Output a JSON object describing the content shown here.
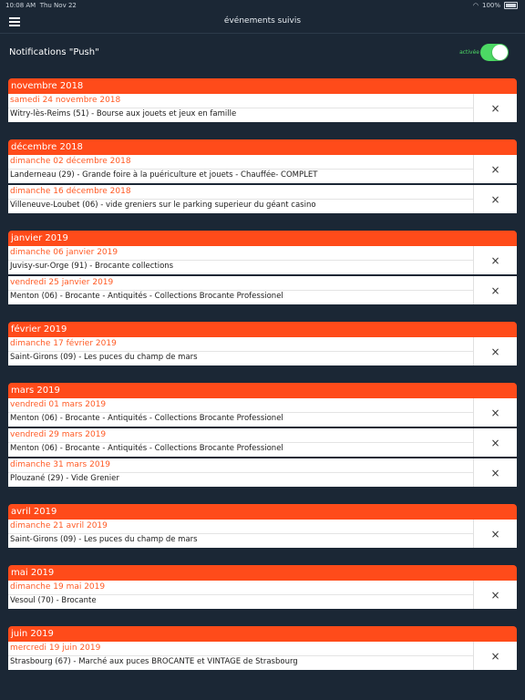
{
  "status": {
    "time": "10:08 AM",
    "date": "Thu Nov 22",
    "battery": "100%"
  },
  "nav": {
    "title": "événements suivis"
  },
  "push": {
    "label": "Notifications \"Push\"",
    "state_label": "activée",
    "enabled": true
  },
  "months": [
    {
      "label": "novembre 2018",
      "events": [
        {
          "date": "samedi 24 novembre 2018",
          "title": "Witry-lès-Reims (51) - Bourse aux jouets et jeux en famille"
        }
      ]
    },
    {
      "label": "décembre 2018",
      "events": [
        {
          "date": "dimanche 02 décembre 2018",
          "title": "Landerneau (29) - Grande foire à la puériculture et jouets - Chauffée- COMPLET"
        },
        {
          "date": "dimanche 16 décembre 2018",
          "title": "Villeneuve-Loubet (06) - vide greniers sur le parking superieur du géant casino"
        }
      ]
    },
    {
      "label": "janvier 2019",
      "events": [
        {
          "date": "dimanche 06 janvier 2019",
          "title": "Juvisy-sur-Orge (91) - Brocante collections"
        },
        {
          "date": "vendredi 25 janvier 2019",
          "title": "Menton (06) - Brocante - Antiquités - Collections Brocante Professionel"
        }
      ]
    },
    {
      "label": "février 2019",
      "events": [
        {
          "date": "dimanche 17 février 2019",
          "title": "Saint-Girons (09) - Les puces du champ de mars"
        }
      ]
    },
    {
      "label": "mars 2019",
      "events": [
        {
          "date": "vendredi 01 mars 2019",
          "title": "Menton (06) - Brocante - Antiquités - Collections Brocante Professionel"
        },
        {
          "date": "vendredi 29 mars 2019",
          "title": "Menton (06) - Brocante - Antiquités - Collections Brocante Professionel"
        },
        {
          "date": "dimanche 31 mars 2019",
          "title": "Plouzané (29) - Vide Grenier"
        }
      ]
    },
    {
      "label": "avril 2019",
      "events": [
        {
          "date": "dimanche 21 avril 2019",
          "title": "Saint-Girons (09) - Les puces du champ de mars"
        }
      ]
    },
    {
      "label": "mai 2019",
      "events": [
        {
          "date": "dimanche 19 mai 2019",
          "title": "Vesoul (70) - Brocante"
        }
      ]
    },
    {
      "label": "juin 2019",
      "events": [
        {
          "date": "mercredi 19 juin 2019",
          "title": "Strasbourg (67) - Marché aux puces BROCANTE et VINTAGE de Strasbourg"
        }
      ]
    }
  ],
  "close_glyph": "×",
  "colors": {
    "background": "#1b2735",
    "accent": "#ff4b1a",
    "toggle_on": "#4cd964"
  }
}
